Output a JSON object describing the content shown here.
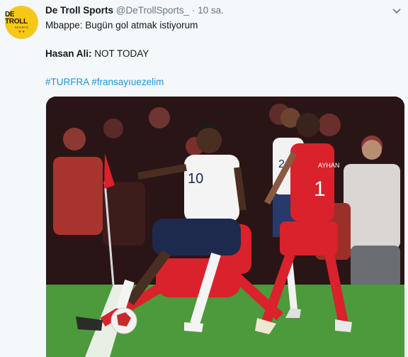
{
  "tweet": {
    "avatar_line1": "DE TROLL",
    "avatar_line2": "SPORTS",
    "display_name": "De Troll Sports",
    "handle": "@DeTrollSports_",
    "separator": "·",
    "timestamp": "10 sa.",
    "line1": "Mbappe: Bugün gol atmak istiyorum",
    "line2_speaker": "Hasan Ali:",
    "line2_text": " NOT TODAY",
    "hashtag1": "#TURFRA",
    "hashtag2": "#fransayıuezelim",
    "photo": {
      "jersey_france_main": "10",
      "jersey_france_back": "2",
      "jersey_turkey": "1",
      "jersey_turkey_name": "AYHAN"
    }
  },
  "colors": {
    "link": "#1b95e0",
    "avatar_bg": "#f6c816",
    "turkey_red": "#d9222b",
    "pitch": "#4c9a3b"
  },
  "icons": [
    "chevron-down-icon"
  ]
}
